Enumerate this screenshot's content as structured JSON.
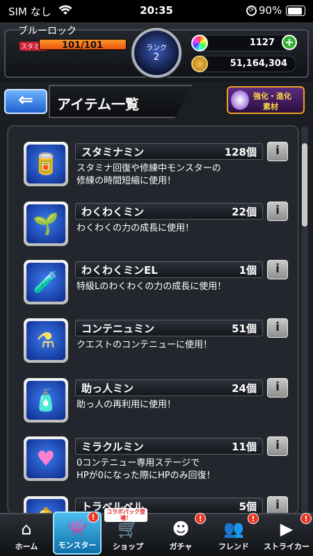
{
  "status_bar": {
    "carrier": "SIM なし",
    "time": "20:35",
    "battery": "90%",
    "battery_level": 0.9
  },
  "player": {
    "name": "ブルーロック",
    "stamina_label": "スタミナ",
    "stamina_text": "101/101",
    "stamina_level": 1.0,
    "rank_label": "ランク",
    "rank": "2",
    "gems": "1127",
    "gold": "51,164,304"
  },
  "title_bar": {
    "back_icon": "back-arrow-icon",
    "title": "アイテム一覧",
    "evo_line1": "強化・進化",
    "evo_line2": "素材"
  },
  "items": [
    {
      "name": "スタミナミン",
      "count": "128個",
      "desc": "スタミナ回復や修練中モンスターの\n修練の時間短縮に使用！",
      "icon": "stamina-can-icon"
    },
    {
      "name": "わくわくミン",
      "count": "22個",
      "desc": "わくわくの力の成長に使用！",
      "icon": "sprout-bottle-icon"
    },
    {
      "name": "わくわくミンEL",
      "count": "1個",
      "desc": "特級Lのわくわくの力の成長に使用！",
      "icon": "el-bottle-icon"
    },
    {
      "name": "コンテニュミン",
      "count": "51個",
      "desc": "クエストのコンテニューに使用！",
      "icon": "continue-flask-icon"
    },
    {
      "name": "助っ人ミン",
      "count": "24個",
      "desc": "助っ人の再利用に使用！",
      "icon": "helper-bottle-icon"
    },
    {
      "name": "ミラクルミン",
      "count": "11個",
      "desc": "0コンテニュー専用ステージで\nHPが0になった際にHPのみ回復！",
      "icon": "heart-potion-icon"
    },
    {
      "name": "トラベルベル",
      "count": "5個",
      "desc": "",
      "icon": "bell-icon"
    }
  ],
  "info_label": "i",
  "tabs": [
    {
      "label": "ホーム",
      "icon": "home-icon",
      "badge": ""
    },
    {
      "label": "モンスター",
      "icon": "monster-icon",
      "badge": "!"
    },
    {
      "label": "ショップ",
      "icon": "cart-icon",
      "badge": "",
      "tag": "コラボパック登場！"
    },
    {
      "label": "ガチャ",
      "icon": "gacha-icon",
      "badge": "!"
    },
    {
      "label": "フレンド",
      "icon": "friend-icon",
      "badge": "!"
    },
    {
      "label": "ストライカー",
      "icon": "striker-icon",
      "badge": "!"
    }
  ],
  "colors": {
    "accent_blue": "#1f5fd0",
    "stamina_orange": "#e8540e",
    "badge_red": "#e32"
  }
}
